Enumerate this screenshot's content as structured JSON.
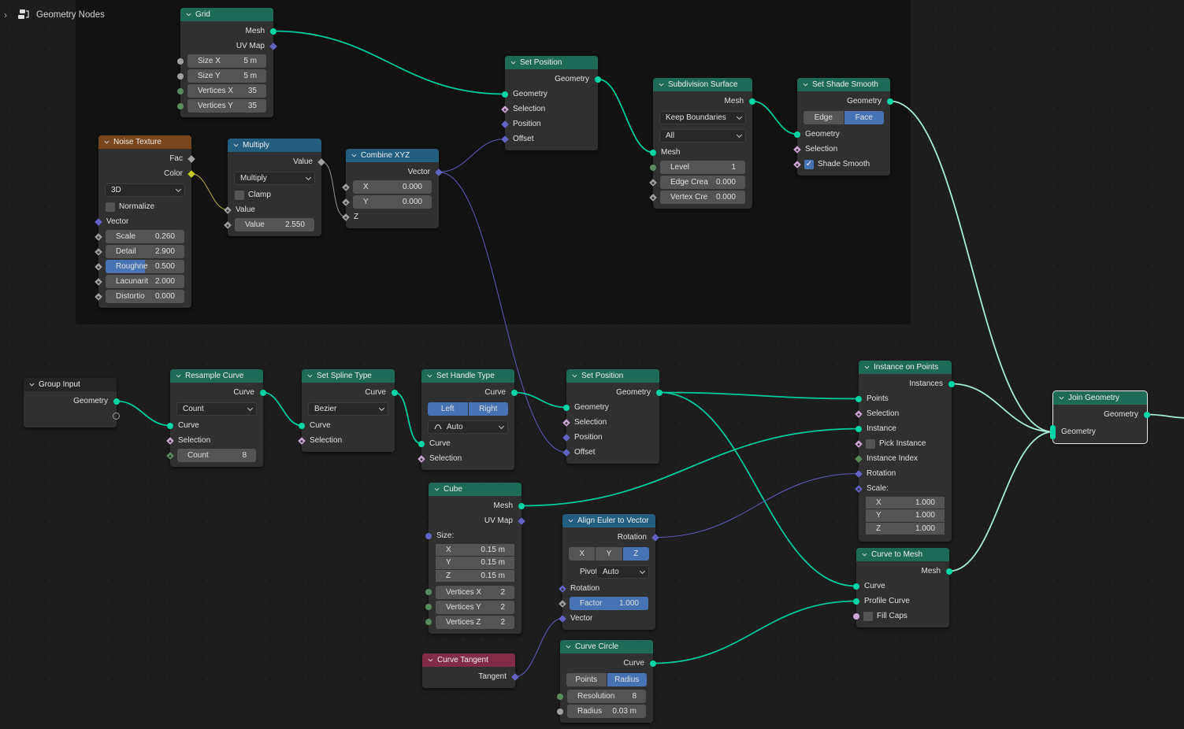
{
  "editor": {
    "title": "Geometry Nodes",
    "expand_icon": "chevron-right-icon",
    "icon": "node-tree-icon"
  },
  "socket_colors": {
    "geometry": "#00d6a3",
    "float": "#a1a1a1",
    "int": "#598c5c",
    "vector": "#6363c7",
    "bool": "#cca6d6",
    "color": "#c7c729",
    "empty": "#9a9a9a"
  },
  "header_colors": {
    "geometry": "#1d6b57",
    "texture": "#7a461c",
    "converter": "#245e7e",
    "input": "#832c47",
    "group": "#242424"
  },
  "link_colors": {
    "geometry": "#00c99a",
    "join": "#a6ecd6",
    "vector": "#5d5dbf",
    "float": "#8f8f8f",
    "color": "#b7ae4a"
  },
  "nodes": [
    {
      "id": "grid",
      "title": "Grid",
      "kind": "geometry",
      "rows": [
        {
          "t": "out",
          "label": "Mesh",
          "s": "geometry",
          "sh": "circle"
        },
        {
          "t": "out",
          "label": "UV Map",
          "s": "vector",
          "sh": "diamond"
        },
        {
          "t": "field",
          "label": "Size X",
          "value": "5 m",
          "s": "float",
          "sh": "circle"
        },
        {
          "t": "field",
          "label": "Size Y",
          "value": "5 m",
          "s": "float",
          "sh": "circle"
        },
        {
          "t": "field",
          "label": "Vertices X",
          "value": "35",
          "s": "int",
          "sh": "circle"
        },
        {
          "t": "field",
          "label": "Vertices Y",
          "value": "35",
          "s": "int",
          "sh": "circle"
        }
      ]
    },
    {
      "id": "noise",
      "title": "Noise Texture",
      "kind": "texture",
      "rows": [
        {
          "t": "out",
          "label": "Fac",
          "s": "float",
          "sh": "diamond"
        },
        {
          "t": "out",
          "label": "Color",
          "s": "color",
          "sh": "diamond"
        },
        {
          "t": "dropdown",
          "value": "3D"
        },
        {
          "t": "check",
          "label": "Normalize",
          "checked": false
        },
        {
          "t": "in",
          "label": "Vector",
          "s": "vector",
          "sh": "diamond"
        },
        {
          "t": "field",
          "label": "Scale",
          "value": "0.260",
          "s": "float",
          "sh": "diamond-dot"
        },
        {
          "t": "field",
          "label": "Detail",
          "value": "2.900",
          "s": "float",
          "sh": "diamond-dot"
        },
        {
          "t": "field",
          "label": "Roughne",
          "value": "0.500",
          "s": "float",
          "sh": "diamond-dot",
          "fill": 0.5
        },
        {
          "t": "field",
          "label": "Lacunarit",
          "value": "2.000",
          "s": "float",
          "sh": "diamond-dot"
        },
        {
          "t": "field",
          "label": "Distortio",
          "value": "0.000",
          "s": "float",
          "sh": "diamond-dot"
        }
      ]
    },
    {
      "id": "mult",
      "title": "Multiply",
      "kind": "converter",
      "rows": [
        {
          "t": "out",
          "label": "Value",
          "s": "float",
          "sh": "diamond"
        },
        {
          "t": "dropdown",
          "value": "Multiply"
        },
        {
          "t": "check",
          "label": "Clamp",
          "checked": false
        },
        {
          "t": "in",
          "label": "Value",
          "s": "float",
          "sh": "diamond-dot"
        },
        {
          "t": "field",
          "label": "Value",
          "value": "2.550",
          "s": "float",
          "sh": "diamond-dot"
        }
      ]
    },
    {
      "id": "combine",
      "title": "Combine XYZ",
      "kind": "converter",
      "rows": [
        {
          "t": "out",
          "label": "Vector",
          "s": "vector",
          "sh": "diamond"
        },
        {
          "t": "field",
          "label": "X",
          "value": "0.000",
          "s": "float",
          "sh": "diamond-dot"
        },
        {
          "t": "field",
          "label": "Y",
          "value": "0.000",
          "s": "float",
          "sh": "diamond-dot"
        },
        {
          "t": "in",
          "label": "Z",
          "s": "float",
          "sh": "diamond-dot"
        }
      ]
    },
    {
      "id": "setpos1",
      "title": "Set Position",
      "kind": "geometry",
      "rows": [
        {
          "t": "out",
          "label": "Geometry",
          "s": "geometry",
          "sh": "circle"
        },
        {
          "t": "in",
          "label": "Geometry",
          "s": "geometry",
          "sh": "circle"
        },
        {
          "t": "in",
          "label": "Selection",
          "s": "bool",
          "sh": "diamond-dot"
        },
        {
          "t": "in",
          "label": "Position",
          "s": "vector",
          "sh": "diamond"
        },
        {
          "t": "in",
          "label": "Offset",
          "s": "vector",
          "sh": "diamond"
        }
      ]
    },
    {
      "id": "subdiv",
      "title": "Subdivision Surface",
      "kind": "geometry",
      "rows": [
        {
          "t": "out",
          "label": "Mesh",
          "s": "geometry",
          "sh": "circle"
        },
        {
          "t": "dropdown",
          "value": "Keep Boundaries"
        },
        {
          "t": "dropdown",
          "value": "All"
        },
        {
          "t": "in",
          "label": "Mesh",
          "s": "geometry",
          "sh": "circle"
        },
        {
          "t": "field",
          "label": "Level",
          "value": "1",
          "s": "int",
          "sh": "circle"
        },
        {
          "t": "field",
          "label": "Edge Crea",
          "value": "0.000",
          "s": "float",
          "sh": "diamond-dot"
        },
        {
          "t": "field",
          "label": "Vertex Cre",
          "value": "0.000",
          "s": "float",
          "sh": "diamond-dot"
        }
      ]
    },
    {
      "id": "shade",
      "title": "Set Shade Smooth",
      "kind": "geometry",
      "rows": [
        {
          "t": "out",
          "label": "Geometry",
          "s": "geometry",
          "sh": "circle"
        },
        {
          "t": "toggle",
          "options": [
            "Edge",
            "Face"
          ],
          "active": [
            "Face"
          ]
        },
        {
          "t": "in",
          "label": "Geometry",
          "s": "geometry",
          "sh": "circle"
        },
        {
          "t": "in",
          "label": "Selection",
          "s": "bool",
          "sh": "diamond-dot"
        },
        {
          "t": "check",
          "label": "Shade Smooth",
          "checked": true,
          "s": "bool",
          "sh": "diamond-dot"
        }
      ]
    },
    {
      "id": "groupin",
      "title": "Group Input",
      "kind": "group",
      "rows": [
        {
          "t": "out",
          "label": "Geometry",
          "s": "geometry",
          "sh": "circle"
        },
        {
          "t": "empty",
          "s": "empty"
        }
      ]
    },
    {
      "id": "resample",
      "title": "Resample Curve",
      "kind": "geometry",
      "rows": [
        {
          "t": "out",
          "label": "Curve",
          "s": "geometry",
          "sh": "circle"
        },
        {
          "t": "dropdown",
          "value": "Count"
        },
        {
          "t": "in",
          "label": "Curve",
          "s": "geometry",
          "sh": "circle"
        },
        {
          "t": "in",
          "label": "Selection",
          "s": "bool",
          "sh": "diamond-dot"
        },
        {
          "t": "field",
          "label": "Count",
          "value": "8",
          "s": "int",
          "sh": "diamond-dot"
        }
      ]
    },
    {
      "id": "spline",
      "title": "Set Spline Type",
      "kind": "geometry",
      "rows": [
        {
          "t": "out",
          "label": "Curve",
          "s": "geometry",
          "sh": "circle"
        },
        {
          "t": "dropdown",
          "value": "Bezier"
        },
        {
          "t": "in",
          "label": "Curve",
          "s": "geometry",
          "sh": "circle"
        },
        {
          "t": "in",
          "label": "Selection",
          "s": "bool",
          "sh": "diamond-dot"
        }
      ]
    },
    {
      "id": "handle",
      "title": "Set Handle Type",
      "kind": "geometry",
      "rows": [
        {
          "t": "out",
          "label": "Curve",
          "s": "geometry",
          "sh": "circle"
        },
        {
          "t": "toggle",
          "options": [
            "Left",
            "Right"
          ],
          "active": [
            "Left",
            "Right"
          ]
        },
        {
          "t": "dropdown",
          "value": "Auto",
          "icon": "handle-auto-icon"
        },
        {
          "t": "in",
          "label": "Curve",
          "s": "geometry",
          "sh": "circle"
        },
        {
          "t": "in",
          "label": "Selection",
          "s": "bool",
          "sh": "diamond-dot"
        }
      ]
    },
    {
      "id": "setpos2",
      "title": "Set Position",
      "kind": "geometry",
      "rows": [
        {
          "t": "out",
          "label": "Geometry",
          "s": "geometry",
          "sh": "circle"
        },
        {
          "t": "in",
          "label": "Geometry",
          "s": "geometry",
          "sh": "circle"
        },
        {
          "t": "in",
          "label": "Selection",
          "s": "bool",
          "sh": "diamond-dot"
        },
        {
          "t": "in",
          "label": "Position",
          "s": "vector",
          "sh": "diamond"
        },
        {
          "t": "in",
          "label": "Offset",
          "s": "vector",
          "sh": "diamond"
        }
      ]
    },
    {
      "id": "cube",
      "title": "Cube",
      "kind": "geometry",
      "rows": [
        {
          "t": "out",
          "label": "Mesh",
          "s": "geometry",
          "sh": "circle"
        },
        {
          "t": "out",
          "label": "UV Map",
          "s": "vector",
          "sh": "diamond"
        },
        {
          "t": "in",
          "label": "Size:",
          "s": "vector",
          "sh": "circle"
        },
        {
          "t": "vec",
          "items": [
            {
              "label": "X",
              "value": "0.15 m"
            },
            {
              "label": "Y",
              "value": "0.15 m"
            },
            {
              "label": "Z",
              "value": "0.15 m"
            }
          ]
        },
        {
          "t": "field",
          "label": "Vertices X",
          "value": "2",
          "s": "int",
          "sh": "circle",
          "gap": true
        },
        {
          "t": "field",
          "label": "Vertices Y",
          "value": "2",
          "s": "int",
          "sh": "circle"
        },
        {
          "t": "field",
          "label": "Vertices Z",
          "value": "2",
          "s": "int",
          "sh": "circle"
        }
      ]
    },
    {
      "id": "tangent",
      "title": "Curve Tangent",
      "kind": "input",
      "rows": [
        {
          "t": "out",
          "label": "Tangent",
          "s": "vector",
          "sh": "diamond"
        }
      ]
    },
    {
      "id": "euler",
      "title": "Align Euler to Vector",
      "kind": "converter",
      "rows": [
        {
          "t": "out",
          "label": "Rotation",
          "s": "vector",
          "sh": "diamond"
        },
        {
          "t": "toggle",
          "options": [
            "X",
            "Y",
            "Z"
          ],
          "active": [
            "Z"
          ]
        },
        {
          "t": "pivot",
          "label": "Pivot",
          "value": "Auto"
        },
        {
          "t": "in",
          "label": "Rotation",
          "s": "vector",
          "sh": "diamond-dot"
        },
        {
          "t": "field",
          "label": "Factor",
          "value": "1.000",
          "s": "float",
          "sh": "diamond-dot",
          "fill": 1.0
        },
        {
          "t": "in",
          "label": "Vector",
          "s": "vector",
          "sh": "diamond"
        }
      ]
    },
    {
      "id": "circle",
      "title": "Curve Circle",
      "kind": "geometry",
      "rows": [
        {
          "t": "out",
          "label": "Curve",
          "s": "geometry",
          "sh": "circle"
        },
        {
          "t": "toggle",
          "options": [
            "Points",
            "Radius"
          ],
          "active": [
            "Radius"
          ]
        },
        {
          "t": "field",
          "label": "Resolution",
          "value": "8",
          "s": "int",
          "sh": "circle"
        },
        {
          "t": "field",
          "label": "Radius",
          "value": "0.03 m",
          "s": "float",
          "sh": "circle"
        }
      ]
    },
    {
      "id": "iop",
      "title": "Instance on Points",
      "kind": "geometry",
      "rows": [
        {
          "t": "out",
          "label": "Instances",
          "s": "geometry",
          "sh": "circle"
        },
        {
          "t": "in",
          "label": "Points",
          "s": "geometry",
          "sh": "circle"
        },
        {
          "t": "in",
          "label": "Selection",
          "s": "bool",
          "sh": "diamond-dot"
        },
        {
          "t": "in",
          "label": "Instance",
          "s": "geometry",
          "sh": "circle"
        },
        {
          "t": "check",
          "label": "Pick Instance",
          "checked": false,
          "s": "bool",
          "sh": "diamond-dot"
        },
        {
          "t": "in",
          "label": "Instance Index",
          "s": "int",
          "sh": "diamond"
        },
        {
          "t": "in",
          "label": "Rotation",
          "s": "vector",
          "sh": "diamond"
        },
        {
          "t": "in",
          "label": "Scale:",
          "s": "vector",
          "sh": "diamond-dot"
        },
        {
          "t": "vec",
          "items": [
            {
              "label": "X",
              "value": "1.000"
            },
            {
              "label": "Y",
              "value": "1.000"
            },
            {
              "label": "Z",
              "value": "1.000"
            }
          ]
        }
      ]
    },
    {
      "id": "c2m",
      "title": "Curve to Mesh",
      "kind": "geometry",
      "rows": [
        {
          "t": "out",
          "label": "Mesh",
          "s": "geometry",
          "sh": "circle"
        },
        {
          "t": "in",
          "label": "Curve",
          "s": "geometry",
          "sh": "circle"
        },
        {
          "t": "in",
          "label": "Profile Curve",
          "s": "geometry",
          "sh": "circle"
        },
        {
          "t": "check",
          "label": "Fill Caps",
          "checked": false,
          "s": "bool",
          "sh": "circle"
        }
      ]
    },
    {
      "id": "join",
      "title": "Join Geometry",
      "kind": "geometry",
      "selected": true,
      "rows": [
        {
          "t": "out",
          "label": "Geometry",
          "s": "geometry",
          "sh": "circle"
        },
        {
          "t": "in",
          "label": "Geometry",
          "s": "geometry",
          "sh": "multi",
          "gap": true
        }
      ]
    }
  ]
}
